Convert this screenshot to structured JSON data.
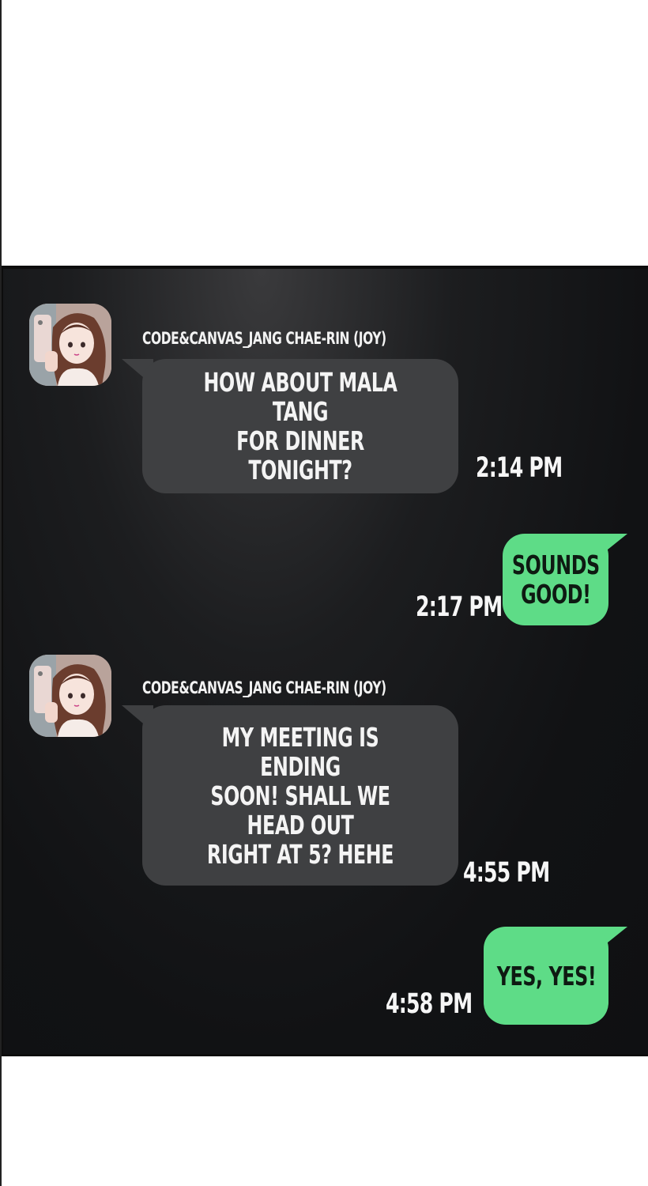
{
  "chat": {
    "messages": [
      {
        "direction": "incoming",
        "sender": "CODE&CANVAS_JANG CHAE-RIN (JOY)",
        "text": "HOW ABOUT MALA TANG\nFOR DINNER TONIGHT?",
        "time": "2:14 PM"
      },
      {
        "direction": "outgoing",
        "text": "SOUNDS\nGOOD!",
        "time": "2:17 PM"
      },
      {
        "direction": "incoming",
        "sender": "CODE&CANVAS_JANG CHAE-RIN (JOY)",
        "text": "MY MEETING IS ENDING\nSOON! SHALL WE HEAD OUT\nRIGHT AT 5? HEHE",
        "time": "4:55 PM"
      },
      {
        "direction": "outgoing",
        "text": "YES, YES!",
        "time": "4:58 PM"
      }
    ]
  },
  "colors": {
    "incoming_bubble": "#3f4042",
    "outgoing_bubble": "#5edc87",
    "panel_background": "#141517",
    "page_background": "#ffffff"
  },
  "icons": {
    "avatar": "profile-photo-avatar"
  }
}
